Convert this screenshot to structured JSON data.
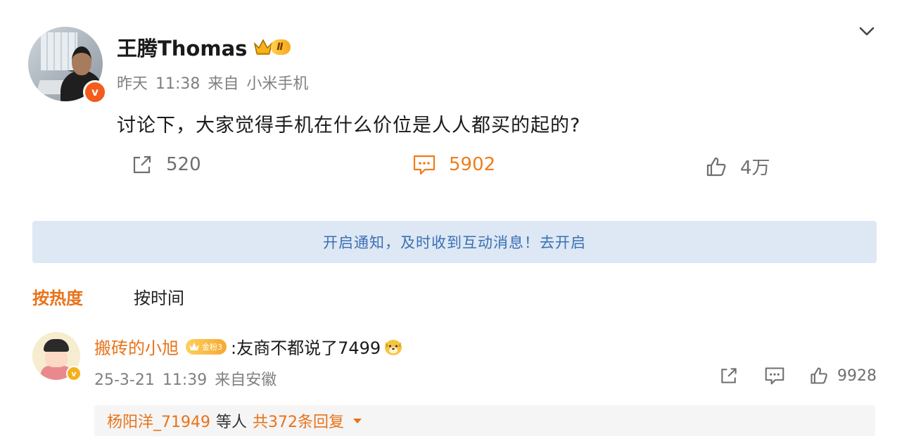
{
  "post": {
    "username": "王腾Thomas",
    "vip_level": "Ⅱ",
    "verify_glyph": "v",
    "time": "昨天 11:38",
    "source_prefix": "来自",
    "source": "小米手机",
    "text": "讨论下，大家觉得手机在什么价位是人人都买的起的?",
    "reposts": "520",
    "comments": "5902",
    "likes": "4万"
  },
  "notify_bar": {
    "text": "开启通知，及时收到互动消息！去开启"
  },
  "sort": {
    "hot": "按热度",
    "time": "按时间"
  },
  "comment": {
    "username": "搬砖的小旭",
    "fan_badge": "金粉3",
    "text": ":友商不都说了7499",
    "time": "25-3-21 11:39",
    "location": "来自安徽",
    "likes": "9928",
    "verify_glyph": "v"
  },
  "replies": {
    "user": "杨阳洋_71949",
    "middle": "等人",
    "count": "共372条回复"
  },
  "colors": {
    "accent_orange": "#e8731a",
    "notify_bg": "#dde8f4",
    "notify_text": "#3b6fb4"
  },
  "icons": [
    "chevron-down-icon",
    "repost-icon",
    "comment-icon",
    "like-icon",
    "crown-icon",
    "dog-emoji-icon",
    "caret-down-icon"
  ]
}
